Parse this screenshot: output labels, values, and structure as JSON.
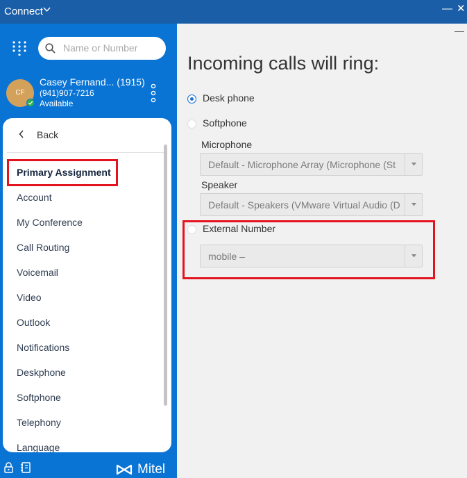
{
  "window": {
    "title": "Connect",
    "minimize_glyph": "—",
    "close_glyph": "✕"
  },
  "search": {
    "placeholder": "Name or Number"
  },
  "profile": {
    "initials": "CF",
    "name": "Casey Fernand... (1915)",
    "number": "(941)907-7216",
    "status": "Available"
  },
  "menu": {
    "back_label": "Back",
    "items": [
      "Primary Assignment",
      "Account",
      "My Conference",
      "Call Routing",
      "Voicemail",
      "Video",
      "Outlook",
      "Notifications",
      "Deskphone",
      "Softphone",
      "Telephony",
      "Language"
    ],
    "active_index": 0
  },
  "brand": {
    "name": "Mitel"
  },
  "pane": {
    "minimize_glyph": "—",
    "heading": "Incoming calls will ring:",
    "options": {
      "desk_phone": {
        "label": "Desk phone",
        "selected": true
      },
      "softphone": {
        "label": "Softphone",
        "selected": false
      },
      "external": {
        "label": "External Number",
        "selected": false
      }
    },
    "microphone": {
      "label": "Microphone",
      "value": "Default - Microphone Array (Microphone (St"
    },
    "speaker": {
      "label": "Speaker",
      "value": "Default - Speakers (VMware Virtual Audio (D"
    },
    "external_number": {
      "value": "mobile –"
    }
  },
  "colors": {
    "titlebar": "#1b5ea8",
    "sidebar": "#0a74d4",
    "highlight_box": "#e3131f",
    "presence_available": "#2db34a"
  },
  "icons": {
    "dialpad": "dialpad-icon",
    "search": "search-icon",
    "more": "kebab-icon",
    "back": "chevron-left-icon",
    "lock": "lock-icon",
    "directory": "contact-card-icon"
  }
}
